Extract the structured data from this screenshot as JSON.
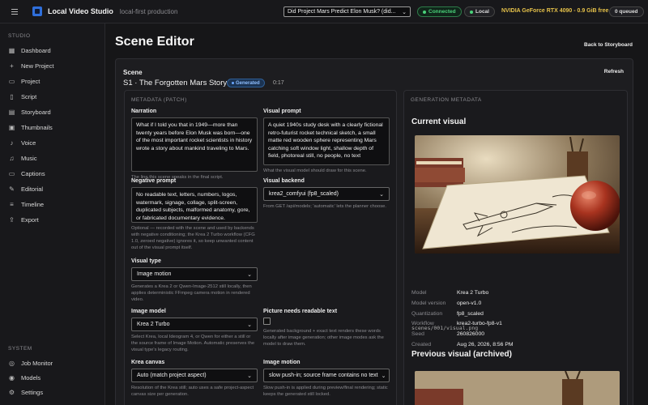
{
  "app": {
    "title": "Local Video Studio",
    "subtitle": "local-first production"
  },
  "topbar": {
    "project_select": "Did Project Mars Predict Elon Musk? (did...",
    "status_connected": "Connected",
    "status_local": "Local",
    "gpu": "NVIDIA GeForce RTX 4090 - 0.9 GiB free",
    "queue": "0 queued"
  },
  "sidebar": {
    "studio_heading": "STUDIO",
    "items": [
      {
        "label": "Dashboard",
        "icon": "grid-icon"
      },
      {
        "label": "New Project",
        "icon": "plus-icon"
      },
      {
        "label": "Project",
        "icon": "folder-icon"
      },
      {
        "label": "Script",
        "icon": "file-icon"
      },
      {
        "label": "Storyboard",
        "icon": "book-icon"
      },
      {
        "label": "Thumbnails",
        "icon": "image-icon"
      },
      {
        "label": "Voice",
        "icon": "mic-icon"
      },
      {
        "label": "Music",
        "icon": "music-icon"
      },
      {
        "label": "Captions",
        "icon": "captions-icon"
      },
      {
        "label": "Editorial",
        "icon": "edit-icon"
      },
      {
        "label": "Timeline",
        "icon": "timeline-icon"
      },
      {
        "label": "Export",
        "icon": "export-icon"
      }
    ],
    "system_heading": "SYSTEM",
    "system_items": [
      {
        "label": "Job Monitor",
        "icon": "monitor-icon"
      },
      {
        "label": "Models",
        "icon": "models-icon"
      },
      {
        "label": "Settings",
        "icon": "gear-icon"
      }
    ]
  },
  "page": {
    "title": "Scene Editor",
    "back_label": "Back to Storyboard"
  },
  "scene": {
    "label": "Scene",
    "name": "S1 · The Forgotten Mars Story",
    "status": "Generated",
    "duration": "0:17",
    "refresh_label": "Refresh"
  },
  "metadata": {
    "heading": "METADATA (PATCH)",
    "narration": {
      "label": "Narration",
      "value": "What if I told you that in 1949—more than twenty years before Elon Musk was born—one of the most important rocket scientists in history wrote a story about mankind traveling to Mars.",
      "help": "The line this scene speaks in the final script."
    },
    "visual_prompt": {
      "label": "Visual prompt",
      "value": "A quiet 1940s study desk with a clearly fictional retro-futurist rocket technical sketch, a small matte red wooden sphere representing Mars catching soft window light, shallow depth of field, photoreal still, no people, no text",
      "help": "What the visual model should draw for this scene."
    },
    "negative_prompt": {
      "label": "Negative prompt",
      "value": "No readable text, letters, numbers, logos, watermark, signage, collage, split-screen, duplicated subjects, malformed anatomy, gore, or fabricated documentary evidence.",
      "help": "Optional — recorded with the scene and used by backends with negative conditioning; the Krea 2 Turbo workflow (CFG 1.0, zeroed negative) ignores it, so keep unwanted content out of the visual prompt itself."
    },
    "visual_backend": {
      "label": "Visual backend",
      "value": "krea2_comfyui (fp8_scaled)",
      "help": "From GET /api/models; 'automatic' lets the planner choose."
    },
    "visual_type": {
      "label": "Visual type",
      "value": "Image motion",
      "help": "Generates a Krea 2 or Qwen-Image-2512 still locally, then applies deterministic FFmpeg camera motion in rendered video."
    },
    "image_model": {
      "label": "Image model",
      "value": "Krea 2 Turbo",
      "help": "Select Krea, local Ideogram 4, or Qwen for either a still or the source frame of Image Motion. Automatic preserves the visual type's legacy routing."
    },
    "readable_text": {
      "label": "Picture needs readable text",
      "help": "Generated background + exact text renders these words locally after image generation; other image modes ask the model to draw them."
    },
    "krea_canvas": {
      "label": "Krea canvas",
      "value": "Auto (match project aspect)",
      "help": "Resolution of the Krea still; auto uses a safe project-aspect canvas size per generation."
    },
    "image_motion": {
      "label": "Image motion",
      "value": "slow push-in; source frame contains no text",
      "help": "Slow push-in is applied during preview/final rendering; static keeps the generated still locked."
    }
  },
  "generation": {
    "heading": "GENERATION METADATA",
    "current_title": "Current visual",
    "fields": [
      {
        "key": "Model",
        "value": "Krea 2 Turbo"
      },
      {
        "key": "Model version",
        "value": "open-v1.0"
      },
      {
        "key": "Quantization",
        "value": "fp8_scaled"
      },
      {
        "key": "Workflow",
        "value": "krea2-turbo-fp8-v1"
      },
      {
        "key": "Seed",
        "value": "260826000"
      },
      {
        "key": "Created",
        "value": "Aug 26, 2026, 8:56 PM"
      }
    ],
    "path": "scenes/001/visual.png",
    "previous_title": "Previous visual (archived)"
  }
}
